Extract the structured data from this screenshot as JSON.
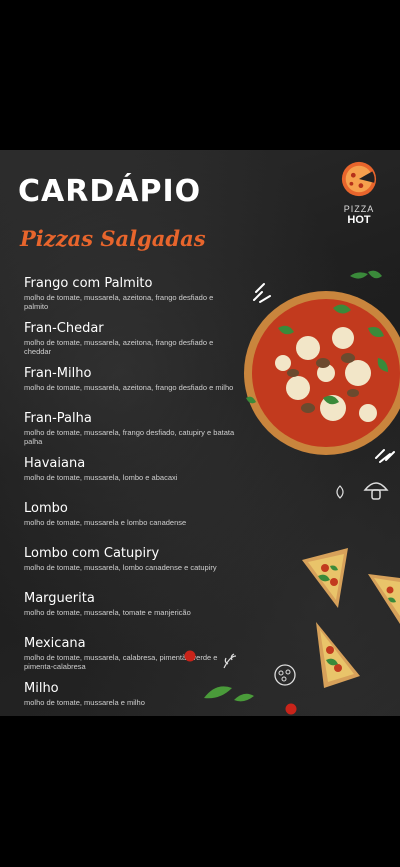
{
  "menu": {
    "title": "CARDÁPIO",
    "subtitle": "Pizzas Salgadas",
    "logo": {
      "small": "PIZZA",
      "big": "HOT"
    },
    "accent_color": "#e8652c",
    "items": [
      {
        "name": "Frango com Palmito",
        "description": "molho de tomate, mussarela, azeitona, frango desfiado e palmito"
      },
      {
        "name": "Fran-Chedar",
        "description": "molho de tomate, mussarela, azeitona, frango desfiado e cheddar"
      },
      {
        "name": "Fran-Milho",
        "description": "molho de tomate, mussarela, azeitona, frango desfiado e milho"
      },
      {
        "name": "Fran-Palha",
        "description": "molho de tomate, mussarela, frango desfiado, catupiry e batata palha"
      },
      {
        "name": "Havaiana",
        "description": "molho de tomate, mussarela, lombo e abacaxi"
      },
      {
        "name": "Lombo",
        "description": "molho de tomate, mussarela e lombo canadense"
      },
      {
        "name": "Lombo com Catupiry",
        "description": "molho de tomate, mussarela, lombo canadense e catupiry"
      },
      {
        "name": "Marguerita",
        "description": "molho de tomate, mussarela, tomate e manjericão"
      },
      {
        "name": "Mexicana",
        "description": "molho de tomate, mussarela, calabresa, pimentão verde e pimenta-calabresa"
      },
      {
        "name": "Milho",
        "description": "molho de tomate, mussarela e milho"
      }
    ]
  }
}
